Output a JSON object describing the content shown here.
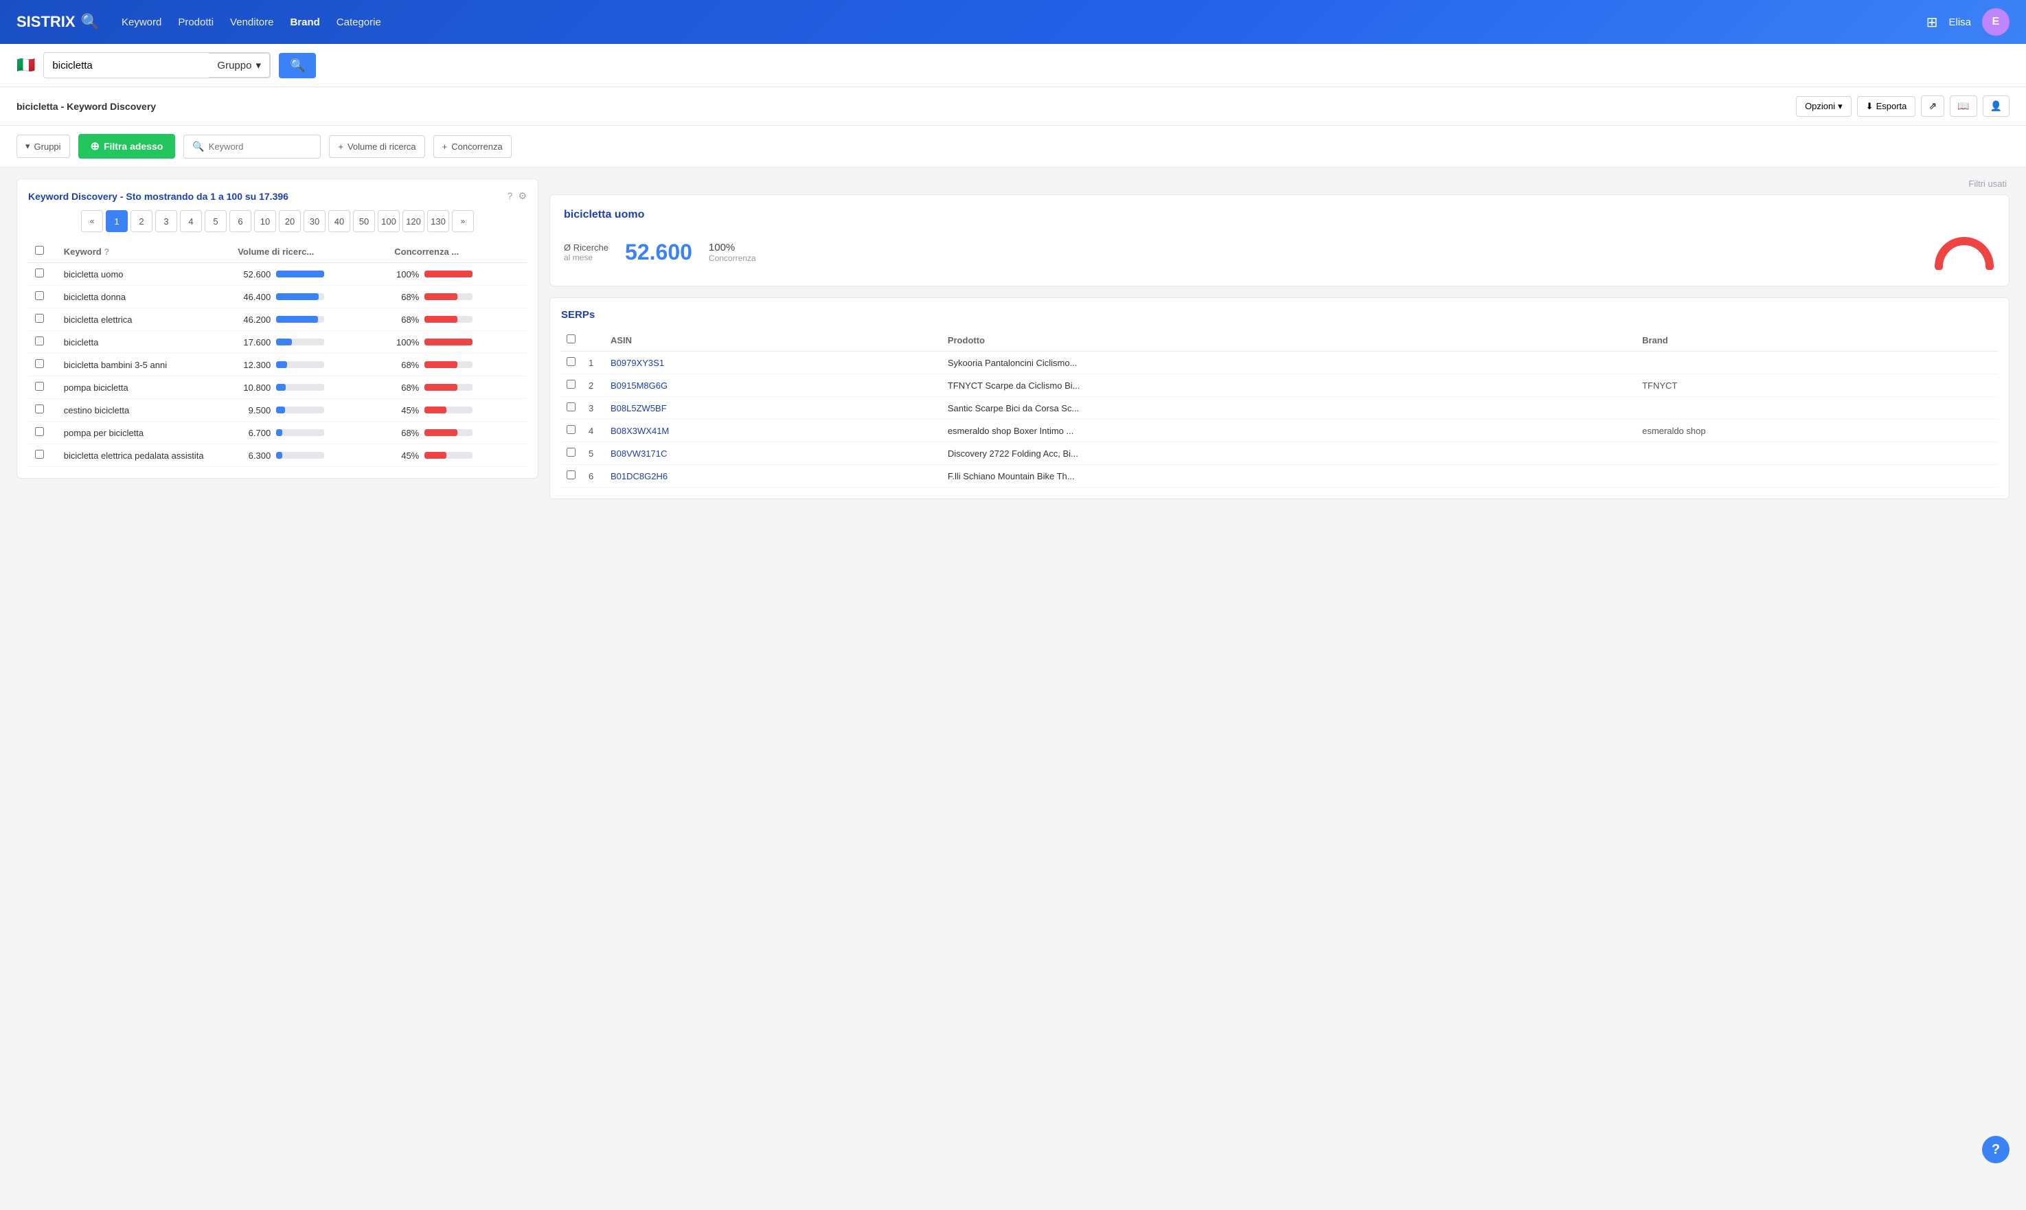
{
  "header": {
    "logo_text": "SISTRIX",
    "nav_items": [
      "Keyword",
      "Prodotti",
      "Venditore",
      "Brand",
      "Categorie"
    ],
    "active_nav": "Brand",
    "user_name": "Elisa"
  },
  "search_bar": {
    "flag": "🇮🇹",
    "query": "bicicletta",
    "dropdown_label": "Gruppo",
    "search_icon": "🔍"
  },
  "page_title": "bicicletta - Keyword Discovery",
  "toolbar": {
    "options_label": "Opzioni",
    "export_label": "Esporta"
  },
  "filters": {
    "gruppi_label": "Gruppi",
    "filtra_label": "Filtra adesso",
    "keyword_placeholder": "Keyword",
    "volume_label": "Volume di ricerca",
    "concorrenza_label": "Concorrenza"
  },
  "filtri_usati_label": "Filtri usati",
  "kd": {
    "title": "Keyword Discovery - Sto mostrando da 1 a 100 su 17.396",
    "pagination": {
      "pages": [
        "«",
        "1",
        "2",
        "3",
        "4",
        "5",
        "6",
        "10",
        "20",
        "30",
        "40",
        "50",
        "100",
        "120",
        "130",
        "»"
      ],
      "active": "1"
    },
    "columns": [
      "",
      "Keyword",
      "Volume di ricerc...",
      "Concorrenza ..."
    ],
    "rows": [
      {
        "keyword": "bicicletta uomo",
        "volume": "52.600",
        "volume_pct": 100,
        "concorrenza": "100%",
        "con_pct": 100
      },
      {
        "keyword": "bicicletta donna",
        "volume": "46.400",
        "volume_pct": 88,
        "concorrenza": "68%",
        "con_pct": 68
      },
      {
        "keyword": "bicicletta elettrica",
        "volume": "46.200",
        "volume_pct": 87,
        "concorrenza": "68%",
        "con_pct": 68
      },
      {
        "keyword": "bicicletta",
        "volume": "17.600",
        "volume_pct": 33,
        "concorrenza": "100%",
        "con_pct": 100
      },
      {
        "keyword": "bicicletta bambini 3-5 anni",
        "volume": "12.300",
        "volume_pct": 23,
        "concorrenza": "68%",
        "con_pct": 68
      },
      {
        "keyword": "pompa bicicletta",
        "volume": "10.800",
        "volume_pct": 20,
        "concorrenza": "68%",
        "con_pct": 68
      },
      {
        "keyword": "cestino bicicletta",
        "volume": "9.500",
        "volume_pct": 18,
        "concorrenza": "45%",
        "con_pct": 45
      },
      {
        "keyword": "pompa per bicicletta",
        "volume": "6.700",
        "volume_pct": 13,
        "concorrenza": "68%",
        "con_pct": 68
      },
      {
        "keyword": "bicicletta elettrica pedalata assistita",
        "volume": "6.300",
        "volume_pct": 12,
        "concorrenza": "45%",
        "con_pct": 45
      }
    ]
  },
  "detail": {
    "keyword": "bicicletta uomo",
    "ricerche_label": "Ø Ricerche",
    "ricerche_sub": "al mese",
    "value": "52.600",
    "pct": "100%",
    "pct_label": "Concorrenza"
  },
  "serps": {
    "title": "SERPs",
    "columns": [
      "",
      "",
      "ASIN",
      "Prodotto",
      "Brand"
    ],
    "rows": [
      {
        "num": 1,
        "asin": "B0979XY3S1",
        "prodotto": "Sykooria Pantaloncini Ciclismo...",
        "brand": ""
      },
      {
        "num": 2,
        "asin": "B0915M8G6G",
        "prodotto": "TFNYCT Scarpe da Ciclismo Bi...",
        "brand": "TFNYCT"
      },
      {
        "num": 3,
        "asin": "B08L5ZW5BF",
        "prodotto": "Santic Scarpe Bici da Corsa Sc...",
        "brand": ""
      },
      {
        "num": 4,
        "asin": "B08X3WX41M",
        "prodotto": "esmeraldo shop Boxer Intimo ...",
        "brand": "esmeraldo shop"
      },
      {
        "num": 5,
        "asin": "B08VW3171C",
        "prodotto": "Discovery 2722 Folding Acc, Bi...",
        "brand": ""
      },
      {
        "num": 6,
        "asin": "B01DC8G2H6",
        "prodotto": "F.lli Schiano Mountain Bike Th...",
        "brand": ""
      }
    ]
  }
}
